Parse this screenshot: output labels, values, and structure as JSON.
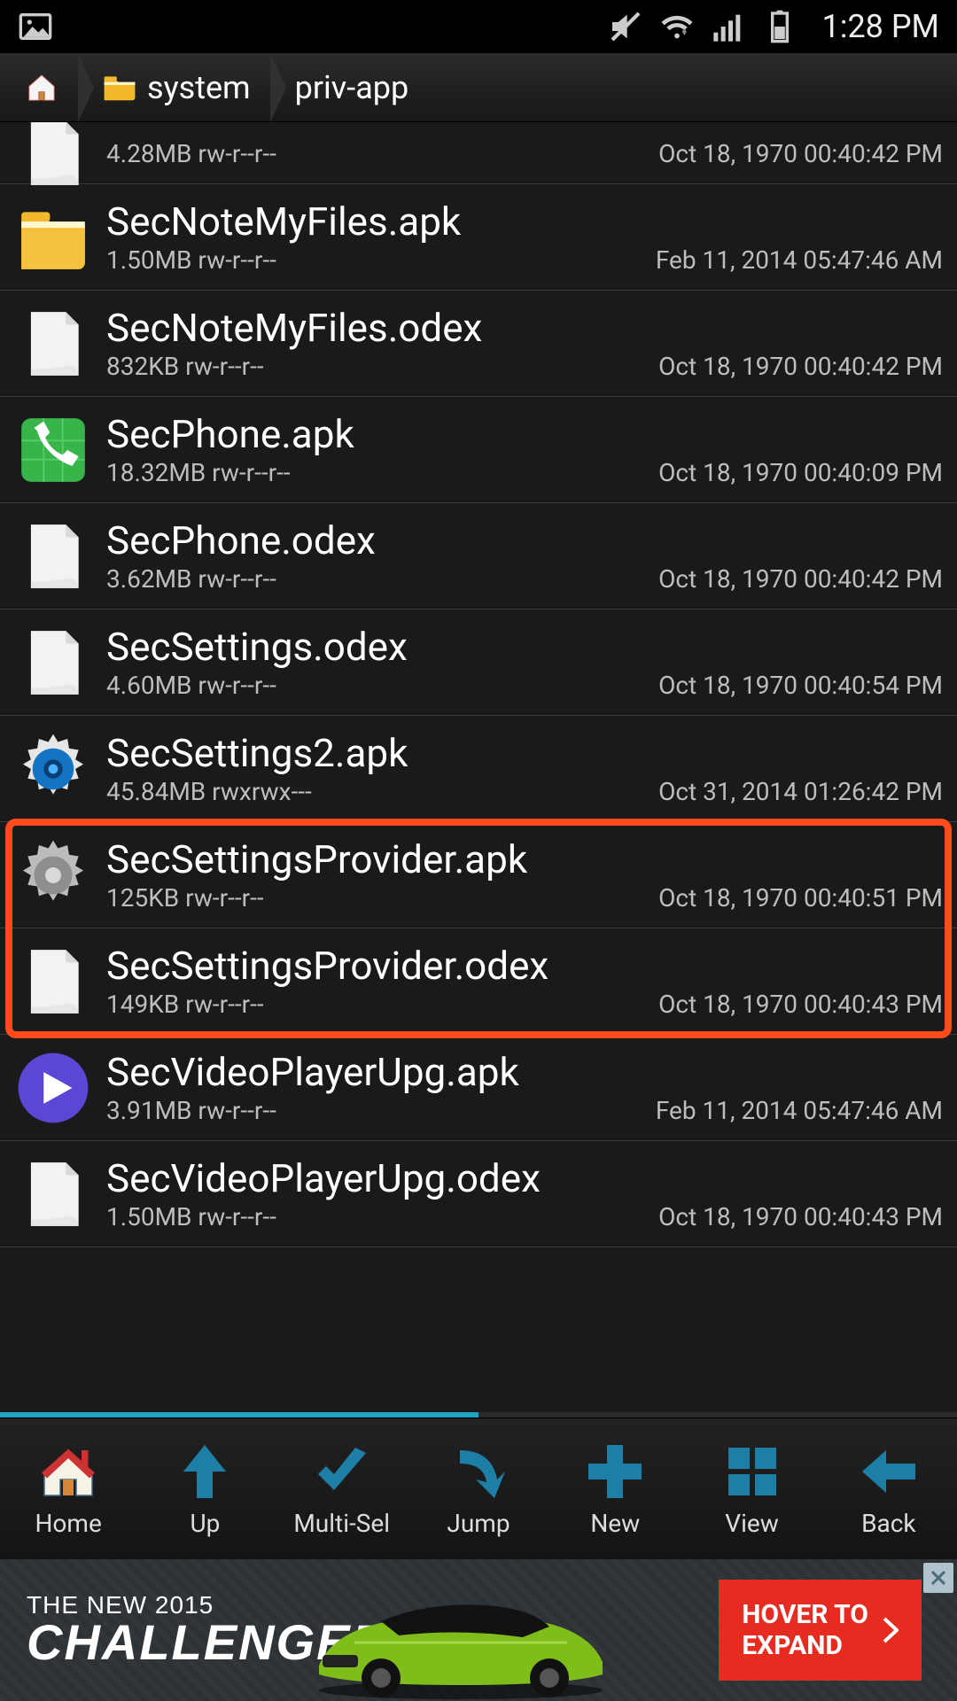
{
  "status": {
    "time": "1:28 PM"
  },
  "breadcrumb": {
    "seg1": "system",
    "seg2": "priv-app"
  },
  "files": [
    {
      "name": "",
      "meta": "4.28MB rw-r--r--",
      "date": "Oct 18, 1970 00:40:42 PM",
      "icon": "file",
      "compact": true
    },
    {
      "name": "SecNoteMyFiles.apk",
      "meta": "1.50MB rw-r--r--",
      "date": "Feb 11, 2014 05:47:46 AM",
      "icon": "folder"
    },
    {
      "name": "SecNoteMyFiles.odex",
      "meta": "832KB rw-r--r--",
      "date": "Oct 18, 1970 00:40:42 PM",
      "icon": "file"
    },
    {
      "name": "SecPhone.apk",
      "meta": "18.32MB rw-r--r--",
      "date": "Oct 18, 1970 00:40:09 PM",
      "icon": "phone"
    },
    {
      "name": "SecPhone.odex",
      "meta": "3.62MB rw-r--r--",
      "date": "Oct 18, 1970 00:40:42 PM",
      "icon": "file"
    },
    {
      "name": "SecSettings.odex",
      "meta": "4.60MB rw-r--r--",
      "date": "Oct 18, 1970 00:40:54 PM",
      "icon": "file"
    },
    {
      "name": "SecSettings2.apk",
      "meta": "45.84MB rwxrwx---",
      "date": "Oct 31, 2014 01:26:42 PM",
      "icon": "gear-blue"
    },
    {
      "name": "SecSettingsProvider.apk",
      "meta": "125KB rw-r--r--",
      "date": "Oct 18, 1970 00:40:51 PM",
      "icon": "gear-gray"
    },
    {
      "name": "SecSettingsProvider.odex",
      "meta": "149KB rw-r--r--",
      "date": "Oct 18, 1970 00:40:43 PM",
      "icon": "file"
    },
    {
      "name": "SecVideoPlayerUpg.apk",
      "meta": "3.91MB rw-r--r--",
      "date": "Feb 11, 2014 05:47:46 AM",
      "icon": "play"
    },
    {
      "name": "SecVideoPlayerUpg.odex",
      "meta": "1.50MB rw-r--r--",
      "date": "Oct 18, 1970 00:40:43 PM",
      "icon": "file"
    }
  ],
  "highlight": {
    "startIndex": 7,
    "endIndex": 8
  },
  "toolbar": {
    "home": "Home",
    "up": "Up",
    "multisel": "Multi-Sel",
    "jump": "Jump",
    "new": "New",
    "view": "View",
    "back": "Back"
  },
  "ad": {
    "line1": "THE NEW 2015",
    "line2": "CHALLENGER",
    "cta1": "HOVER TO",
    "cta2": "EXPAND"
  }
}
